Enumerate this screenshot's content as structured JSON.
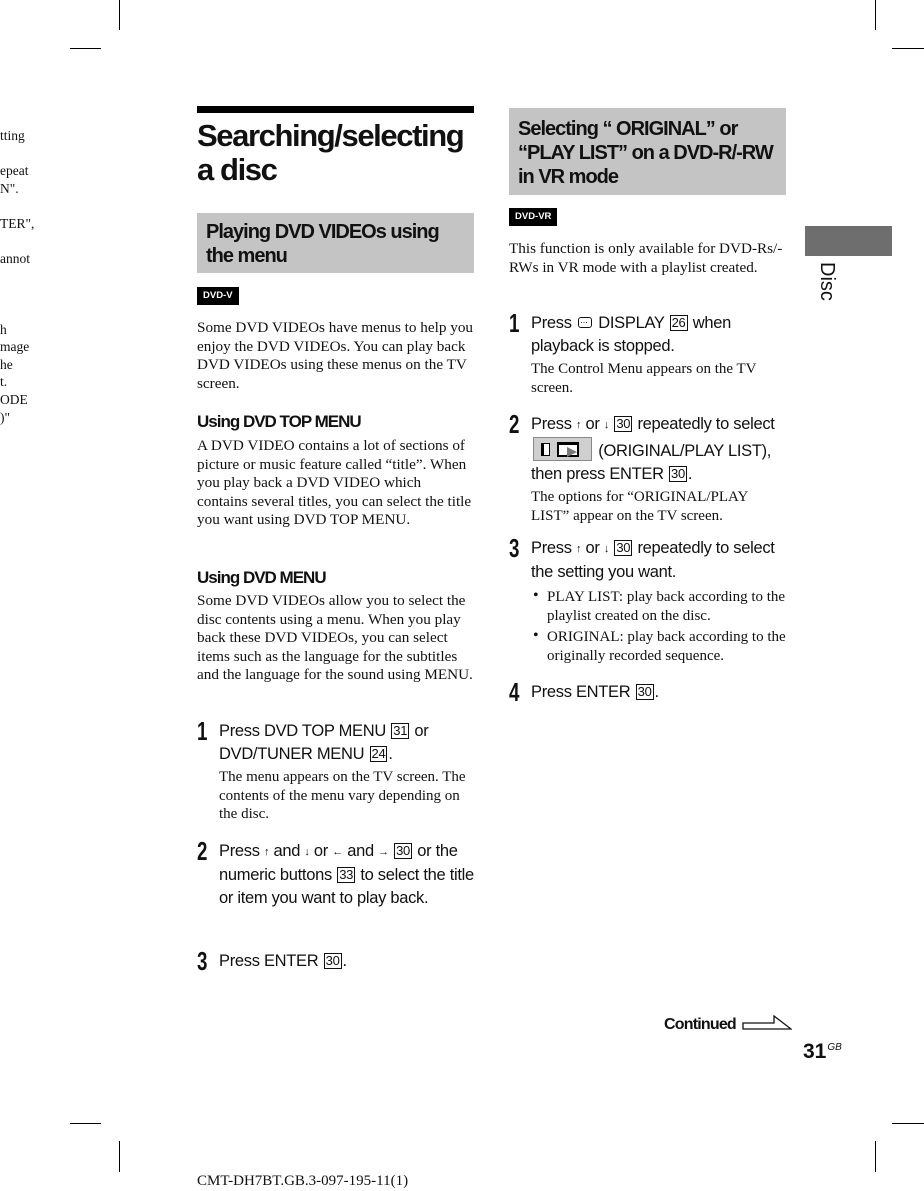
{
  "previous_page_fragment": {
    "lines": [
      "tting",
      "",
      "epeat",
      "N\".",
      "",
      "TER\",",
      "",
      "annot",
      "",
      "",
      "",
      "h",
      "mage",
      "he",
      "t.",
      "ODE",
      ")\""
    ]
  },
  "left_column": {
    "title": "Searching/selecting a disc",
    "section_heading": "Playing DVD VIDEOs using the menu",
    "badge": "DVD-V",
    "intro": "Some DVD VIDEOs have menus to help you enjoy the DVD VIDEOs. You can play back DVD VIDEOs using these menus on the TV screen.",
    "subsections": [
      {
        "heading": "Using DVD TOP MENU",
        "body": "A DVD VIDEO contains a lot of sections of picture or music feature called “title”. When you play back a DVD VIDEO which contains several titles, you can select the title you want using DVD TOP MENU."
      },
      {
        "heading": "Using DVD MENU",
        "body": "Some DVD VIDEOs allow you to select the disc contents using a menu. When you play back these DVD VIDEOs, you can select items such as the language for the subtitles and the language for the sound using MENU."
      }
    ],
    "steps": [
      {
        "number": "1",
        "parts": [
          "Press DVD TOP MENU ",
          "31",
          " or DVD/TUNER MENU ",
          "24",
          "."
        ],
        "note": "The menu appears on the TV screen. The contents of the menu vary depending on the disc."
      },
      {
        "number": "2",
        "parts": [
          "Press ",
          "↑",
          " and ",
          "↓",
          " or ",
          "←",
          " and ",
          "→",
          " ",
          "30",
          " or the numeric buttons ",
          "33",
          " to select the title or item you want to play back."
        ]
      },
      {
        "number": "3",
        "parts": [
          "Press ENTER ",
          "30",
          "."
        ]
      }
    ]
  },
  "right_column": {
    "section_heading": "Selecting “ ORIGINAL” or “PLAY LIST” on a DVD-R/-RW in VR mode",
    "badge": "DVD-VR",
    "intro": "This function is only available for DVD-Rs/-RWs in VR mode with a playlist created.",
    "steps": [
      {
        "number": "1",
        "icon": "display-icon",
        "parts": [
          "Press ",
          " DISPLAY ",
          "26",
          " when playback is stopped."
        ],
        "note": "The Control Menu appears on the TV screen."
      },
      {
        "number": "2",
        "icon": "original-playlist-menu-icon",
        "parts": [
          "Press ",
          "↑",
          " or ",
          "↓",
          " ",
          "30",
          " repeatedly to select ",
          " (ORIGINAL/PLAY LIST), then press ENTER ",
          "30",
          "."
        ],
        "note": "The options for “ORIGINAL/PLAY LIST” appear on the TV screen."
      },
      {
        "number": "3",
        "parts": [
          "Press ",
          "↑",
          " or ",
          "↓",
          " ",
          "30",
          " repeatedly to select the setting you want."
        ],
        "bullets": [
          "PLAY LIST: play back according to the playlist created on the disc.",
          "ORIGINAL: play back according to the originally recorded sequence."
        ]
      },
      {
        "number": "4",
        "parts": [
          "Press ENTER ",
          "30",
          "."
        ]
      }
    ]
  },
  "side_tab": {
    "label": "Disc",
    "color": "#6e6e6e"
  },
  "continued_label": "Continued",
  "page_number": "31",
  "page_suffix": "GB",
  "footer_code": "CMT-DH7BT.GB.3-097-195-11(1)",
  "colors": {
    "section_heading_bg": "#c4c4c4",
    "badge_bg": "#000000"
  }
}
